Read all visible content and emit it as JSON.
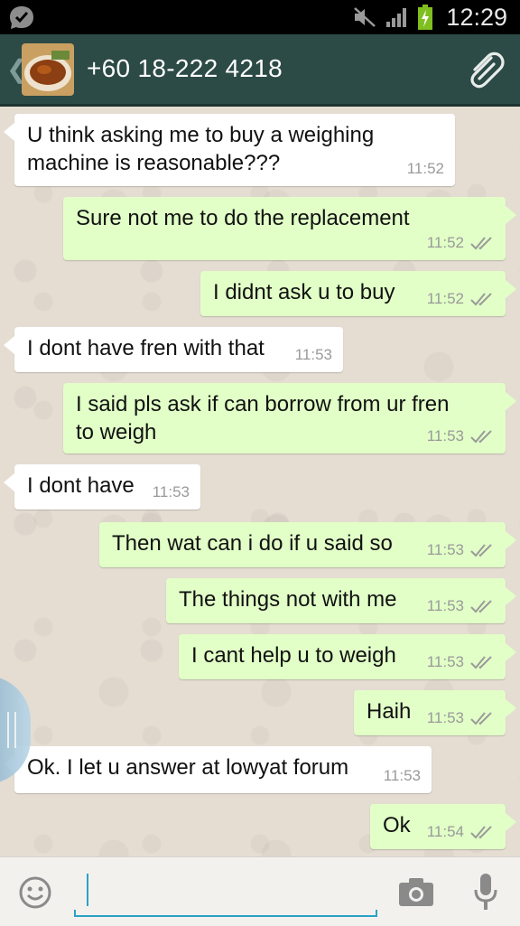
{
  "status_bar": {
    "time": "12:29",
    "icons": [
      "whatsapp-notification-icon",
      "mute-icon",
      "signal-icon",
      "battery-charging-icon"
    ]
  },
  "header": {
    "contact": "+60 18-222 4218",
    "icons": [
      "back-icon",
      "avatar",
      "attachment-icon"
    ]
  },
  "messages": [
    {
      "dir": "in",
      "lines": [
        "U think asking me to buy a weighing",
        "machine is reasonable???"
      ],
      "time": "11:52"
    },
    {
      "dir": "out",
      "lines": [
        "Sure not me to do the replacement"
      ],
      "time": "11:52"
    },
    {
      "dir": "out",
      "lines": [
        "I didnt ask u to buy"
      ],
      "time": "11:52"
    },
    {
      "dir": "in",
      "lines": [
        "I dont have fren with that"
      ],
      "time": "11:53"
    },
    {
      "dir": "out",
      "lines": [
        "I said pls ask if can borrow from ur fren",
        "to weigh"
      ],
      "time": "11:53"
    },
    {
      "dir": "in",
      "lines": [
        "I dont have"
      ],
      "time": "11:53"
    },
    {
      "dir": "out",
      "lines": [
        "Then wat can i do if u said so"
      ],
      "time": "11:53"
    },
    {
      "dir": "out",
      "lines": [
        "The things not with me"
      ],
      "time": "11:53"
    },
    {
      "dir": "out",
      "lines": [
        "I cant help u to weigh"
      ],
      "time": "11:53"
    },
    {
      "dir": "out",
      "lines": [
        "Haih"
      ],
      "time": "11:53"
    },
    {
      "dir": "in",
      "lines": [
        "Ok. I let u answer at lowyat forum"
      ],
      "time": "11:53"
    },
    {
      "dir": "out",
      "lines": [
        "Ok"
      ],
      "time": "11:54"
    }
  ],
  "input_bar": {
    "value": "",
    "placeholder": "",
    "icons": [
      "emoji-icon",
      "camera-icon",
      "microphone-icon"
    ]
  },
  "colors": {
    "header": "#2c4a46",
    "incoming_bubble": "#ffffff",
    "outgoing_bubble": "#e1ffc7",
    "chat_background": "#e5ddd2",
    "input_accent": "#2aa3c4"
  }
}
